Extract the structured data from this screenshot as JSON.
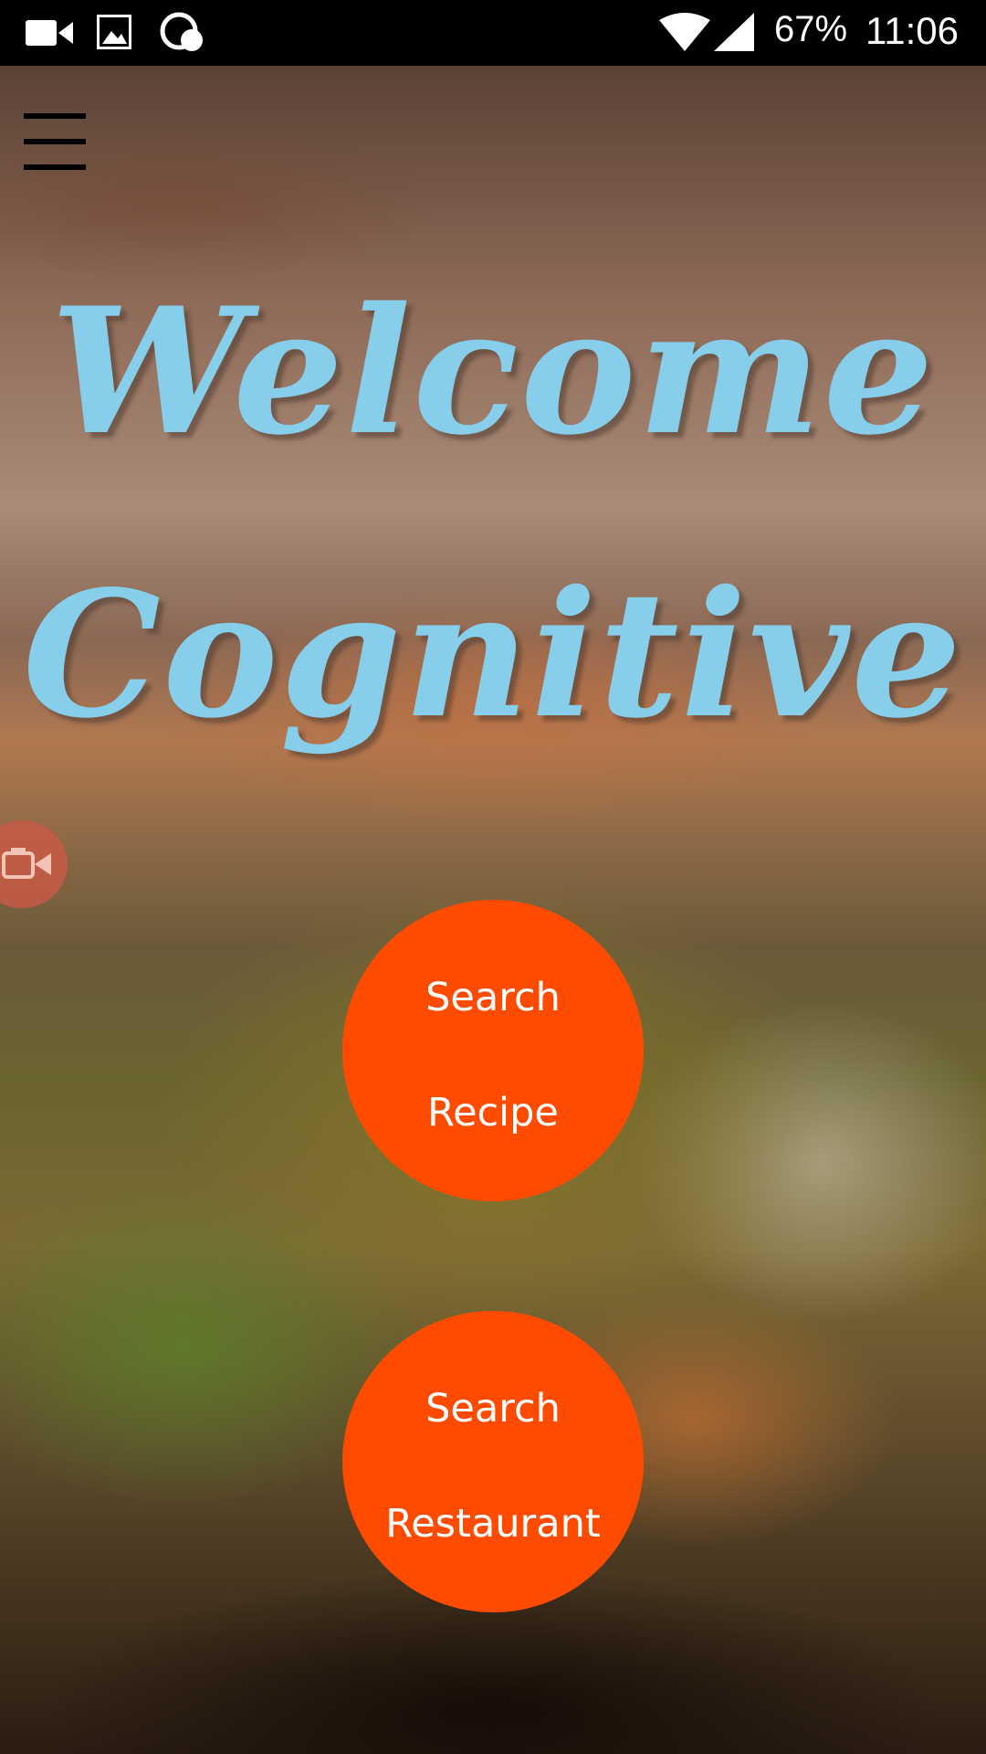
{
  "status_bar": {
    "icons": [
      "video-camera-icon",
      "image-icon",
      "css-app-icon",
      "wifi-icon",
      "cell-signal-icon"
    ],
    "battery": "67%",
    "time": "11:06"
  },
  "header": {
    "menu_icon": "hamburger-menu-icon"
  },
  "hero": {
    "line1": "Welcome",
    "line2": "Cognitive",
    "color": "#87ceeb"
  },
  "floating": {
    "side_button_icon": "camera-switch-icon"
  },
  "actions": {
    "search_recipe": {
      "line1": "Search",
      "line2": "Recipe"
    },
    "search_restaurant": {
      "line1": "Search",
      "line2": "Restaurant"
    },
    "button_color": "#ff4b00"
  }
}
